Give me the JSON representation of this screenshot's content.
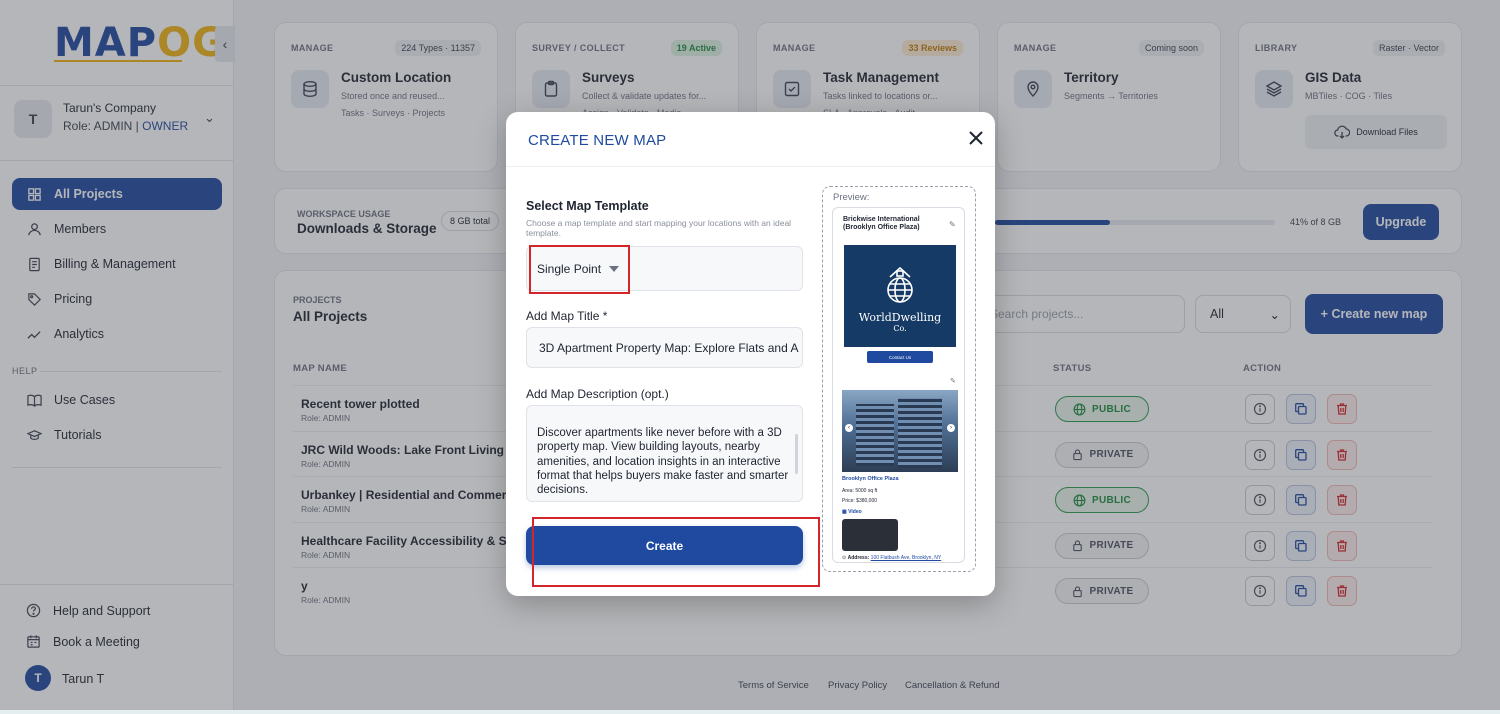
{
  "app": {
    "logo": "MAPOG"
  },
  "sidebar": {
    "company_name": "Tarun's Company",
    "role_prefix": "Role: ADMIN | ",
    "role_owner": "OWNER",
    "avatar_letter": "T",
    "nav": [
      {
        "label": "All Projects",
        "icon": "grid-icon",
        "active": true
      },
      {
        "label": "Members",
        "icon": "user-icon"
      },
      {
        "label": "Billing & Management",
        "icon": "receipt-icon"
      },
      {
        "label": "Pricing",
        "icon": "tag-icon"
      },
      {
        "label": "Analytics",
        "icon": "trend-icon"
      }
    ],
    "help_label": "HELP",
    "help_nav": [
      {
        "label": "Use Cases",
        "icon": "book-icon"
      },
      {
        "label": "Tutorials",
        "icon": "graduation-cap-icon"
      }
    ],
    "bottom": [
      {
        "label": "Help and Support",
        "icon": "help-circle-icon"
      },
      {
        "label": "Book a Meeting",
        "icon": "calendar-icon"
      }
    ],
    "user": {
      "initial": "T",
      "name": "Tarun T"
    }
  },
  "cards": [
    {
      "category": "MANAGE",
      "badge": "224 Types · 11357",
      "title": "Custom Location",
      "sub": "Stored once and reused...",
      "sub2": "Tasks · Surveys · Projects",
      "icon": "database-icon"
    },
    {
      "category": "SURVEY / COLLECT",
      "badge": "19 Active",
      "title": "Surveys",
      "sub": "Collect & validate updates for...",
      "sub2": "Assign · Validate · Media",
      "icon": "clipboard-icon"
    },
    {
      "category": "MANAGE",
      "badge": "33 Reviews",
      "title": "Task Management",
      "sub": "Tasks linked to locations or...",
      "sub2": "SLA · Approvals · Audit",
      "icon": "checkbox-icon"
    },
    {
      "category": "MANAGE",
      "badge": "Coming soon",
      "title": "Territory",
      "sub": "Segments → Territories",
      "sub2": "",
      "icon": "location-pin-icon"
    },
    {
      "category": "LIBRARY",
      "badge": "Raster · Vector",
      "title": "GIS Data",
      "sub": "MBTiles · COG · Tiles",
      "sub2": "",
      "icon": "layers-icon",
      "button": "Download Files"
    }
  ],
  "usage": {
    "label": "WORKSPACE USAGE",
    "title": "Downloads & Storage",
    "total": "8 GB total",
    "percent_text": "41% of 8 GB",
    "percent": 41,
    "upgrade": "Upgrade"
  },
  "projects": {
    "label": "PROJECTS",
    "title": "All Projects",
    "search_placeholder": "Search projects...",
    "filter_value": "All",
    "create_button": "+ Create new map",
    "columns": [
      "MAP NAME",
      "STATUS",
      "ACTION"
    ],
    "rows": [
      {
        "name": "Recent tower plotted",
        "role": "Role: ADMIN",
        "status": "PUBLIC"
      },
      {
        "name": "JRC Wild Woods: Lake Front Living",
        "role": "Role: ADMIN",
        "status": "PRIVATE"
      },
      {
        "name": "Urbankey | Residential and Commercial",
        "role": "Role: ADMIN",
        "status": "PUBLIC"
      },
      {
        "name": "Healthcare Facility Accessibility & Servi",
        "role": "Role: ADMIN",
        "status": "PRIVATE"
      },
      {
        "name": "y",
        "role": "Role: ADMIN",
        "status": "PRIVATE"
      }
    ]
  },
  "footer": {
    "links": [
      "Terms of Service",
      "Privacy Policy",
      "Cancellation & Refund"
    ]
  },
  "modal": {
    "title": "CREATE NEW MAP",
    "template_label": "Select Map Template",
    "template_help": "Choose a map template and start mapping your locations with an ideal template.",
    "template_value": "Single Point",
    "map_title_label": "Add Map Title *",
    "map_title_value": "3D Apartment Property Map: Explore Flats and A",
    "desc_label": "Add Map Description (opt.)",
    "desc_value": "Discover apartments like never before with a 3D property map. View building layouts, nearby amenities, and location insights in an interactive format that helps buyers make faster and smarter decisions.",
    "create_button": "Create",
    "preview_label": "Preview:",
    "preview": {
      "title": "Brickwise International (Brooklyn Office Plaza)",
      "logo_line1": "WorldDwelling",
      "logo_line2": "Co.",
      "contact": "Contact Us",
      "place": "Brooklyn Office Plaza",
      "area": "Area: 5000 sq ft",
      "price": "Price: $380,000",
      "video": "Video",
      "address_label": "Address:",
      "address": "100 Flatbush Ave, Brooklyn, NY"
    }
  }
}
